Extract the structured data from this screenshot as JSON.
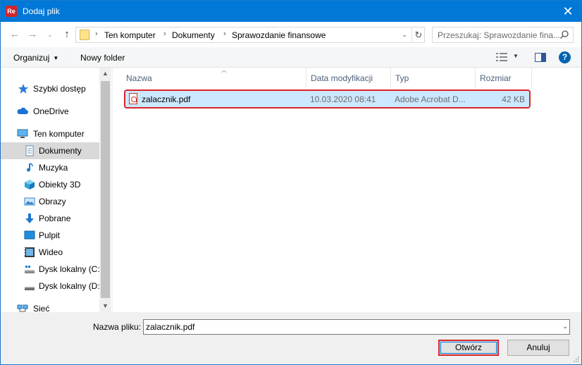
{
  "window": {
    "title": "Dodaj plik",
    "app_icon_text": "Re",
    "close_icon": "close-icon"
  },
  "address": {
    "breadcrumb": [
      "Ten komputer",
      "Dokumenty",
      "Sprawozdanie finansowe"
    ],
    "separator": "›",
    "search_placeholder": "Przeszukaj: Sprawozdanie fina..."
  },
  "toolbar": {
    "organize_label": "Organizuj",
    "new_folder_label": "Nowy folder"
  },
  "sidebar": {
    "items": [
      {
        "label": "Szybki dostęp",
        "icon": "star-icon"
      },
      {
        "label": "OneDrive",
        "icon": "cloud-icon"
      },
      {
        "label": "Ten komputer",
        "icon": "computer-icon"
      },
      {
        "label": "Dokumenty",
        "icon": "documents-icon",
        "selected": true
      },
      {
        "label": "Muzyka",
        "icon": "music-icon"
      },
      {
        "label": "Obiekty 3D",
        "icon": "cube-icon"
      },
      {
        "label": "Obrazy",
        "icon": "pictures-icon"
      },
      {
        "label": "Pobrane",
        "icon": "download-icon"
      },
      {
        "label": "Pulpit",
        "icon": "desktop-icon"
      },
      {
        "label": "Wideo",
        "icon": "video-icon"
      },
      {
        "label": "Dysk lokalny (C:)",
        "icon": "drive-c-icon"
      },
      {
        "label": "Dysk lokalny (D:)",
        "icon": "drive-d-icon"
      },
      {
        "label": "Sieć",
        "icon": "network-icon"
      }
    ]
  },
  "filelist": {
    "columns": [
      "Nazwa",
      "Data modyfikacji",
      "Typ",
      "Rozmiar"
    ],
    "rows": [
      {
        "name": "zalacznik.pdf",
        "modified": "10.03.2020 08:41",
        "type": "Adobe Acrobat D...",
        "size": "42 KB",
        "icon": "pdf-icon"
      }
    ]
  },
  "footer": {
    "filename_label": "Nazwa pliku:",
    "filename_value": "zalacznik.pdf",
    "open_label": "Otwórz",
    "cancel_label": "Anuluj"
  },
  "colors": {
    "titlebar": "#0078d7",
    "selection": "#cce8ff",
    "highlight_outline": "#d9252b"
  }
}
